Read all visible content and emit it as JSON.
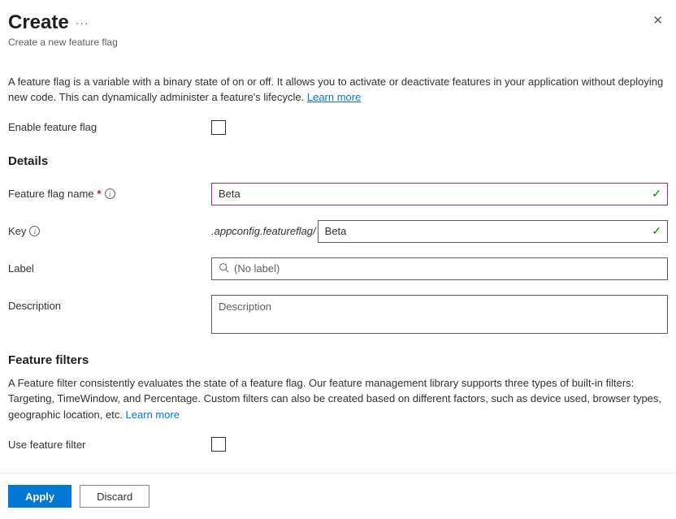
{
  "header": {
    "title": "Create",
    "subtitle": "Create a new feature flag"
  },
  "intro": {
    "text": "A feature flag is a variable with a binary state of on or off. It allows you to activate or deactivate features in your application without deploying new code. This can dynamically administer a feature's lifecycle. ",
    "link": "Learn more"
  },
  "enable": {
    "label": "Enable feature flag"
  },
  "details": {
    "heading": "Details",
    "name_label": "Feature flag name",
    "name_value": "Beta",
    "key_label": "Key",
    "key_prefix": ".appconfig.featureflag/",
    "key_value": "Beta",
    "label_label": "Label",
    "label_placeholder": "(No label)",
    "description_label": "Description",
    "description_placeholder": "Description"
  },
  "filters": {
    "heading": "Feature filters",
    "text": "A Feature filter consistently evaluates the state of a feature flag. Our feature management library supports three types of built-in filters: Targeting, TimeWindow, and Percentage. Custom filters can also be created based on different factors, such as device used, browser types, geographic location, etc. ",
    "link": "Learn more",
    "use_label": "Use feature filter"
  },
  "footer": {
    "apply": "Apply",
    "discard": "Discard"
  }
}
